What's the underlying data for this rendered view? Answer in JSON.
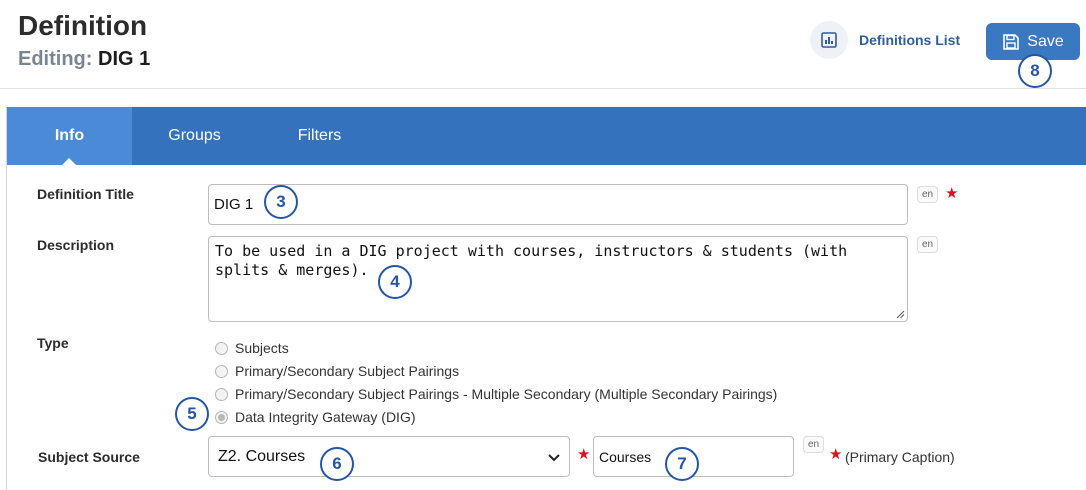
{
  "header": {
    "title": "Definition",
    "editing_prefix": "Editing:",
    "editing_name": "DIG 1",
    "definitions_list_label": "Definitions List",
    "save_label": "Save"
  },
  "tabs": [
    {
      "label": "Info",
      "active": true
    },
    {
      "label": "Groups",
      "active": false
    },
    {
      "label": "Filters",
      "active": false
    }
  ],
  "form": {
    "definition_title_label": "Definition Title",
    "definition_title_value": "DIG 1",
    "description_label": "Description",
    "description_value": "To be used in a DIG project with courses, instructors & students (with splits & merges).",
    "type_label": "Type",
    "type_options": [
      {
        "label": "Subjects",
        "selected": false
      },
      {
        "label": "Primary/Secondary Subject Pairings",
        "selected": false
      },
      {
        "label": "Primary/Secondary Subject Pairings - Multiple Secondary (Multiple Secondary Pairings)",
        "selected": false
      },
      {
        "label": "Data Integrity Gateway (DIG)",
        "selected": true
      }
    ],
    "subject_source_label": "Subject Source",
    "subject_source_value": "Z2. Courses",
    "caption_value": "Courses",
    "caption_note": "(Primary Caption)",
    "lang_code": "en"
  },
  "badges": [
    "8",
    "3",
    "4",
    "5",
    "6",
    "7"
  ],
  "colors": {
    "accent": "#3472bd",
    "active_tab": "#4a8ad6",
    "save_button": "#3a78c2",
    "required_star": "#d7151d",
    "badge": "#2455a6"
  },
  "icons": [
    "chart-icon",
    "save-disk-icon",
    "required-star-icon",
    "chevron-down-icon",
    "resize-handle-icon"
  ]
}
